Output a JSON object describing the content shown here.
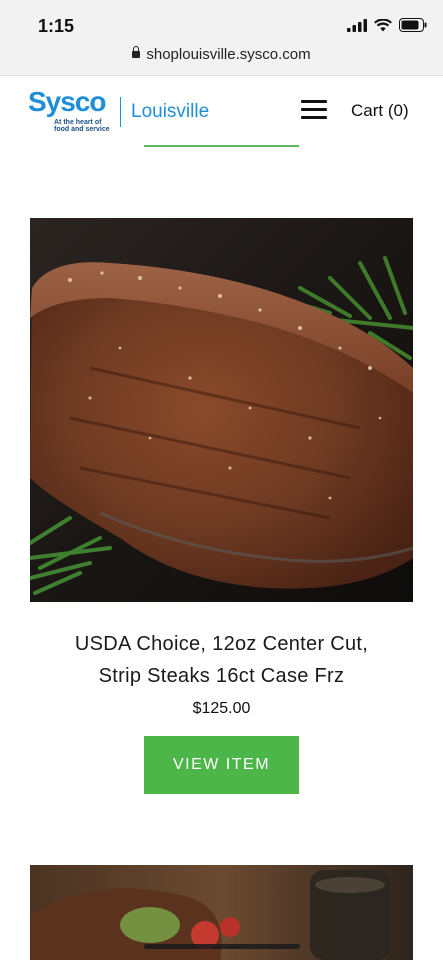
{
  "status_bar": {
    "time": "1:15",
    "url": "shoplouisville.sysco.com",
    "icons": [
      "signal-icon",
      "wifi-icon",
      "battery-icon"
    ]
  },
  "header": {
    "brand": "Sysco",
    "tagline_line1": "At the heart of",
    "tagline_line2": "food and service",
    "city": "Louisville",
    "cart_label": "Cart (0)",
    "brand_color": "#1e8ed8"
  },
  "product": {
    "title_line1": "USDA Choice, 12oz Center Cut,",
    "title_line2": "Strip Steaks 16ct Case Frz",
    "price": "$125.00",
    "button_label": "VIEW ITEM",
    "button_color": "#4cb748"
  }
}
